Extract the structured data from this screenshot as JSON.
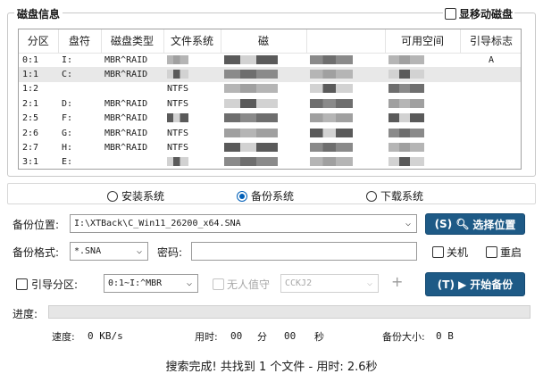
{
  "disk_info": {
    "title": "磁盘信息",
    "show_mobile_disk_label": "显移动磁盘",
    "columns": [
      "分区",
      "盘符",
      "磁盘类型",
      "文件系统",
      "磁",
      "",
      "可用空间",
      "引导标志"
    ],
    "rows": [
      {
        "partition": "0:1",
        "drive": "I:",
        "disk_type": "MBR^RAID",
        "fs": "",
        "boot": "A"
      },
      {
        "partition": "1:1",
        "drive": "C:",
        "disk_type": "MBR^RAID",
        "fs": "",
        "boot": ""
      },
      {
        "partition": "1:2",
        "drive": "",
        "disk_type": "",
        "fs": "NTFS",
        "boot": ""
      },
      {
        "partition": "2:1",
        "drive": "D:",
        "disk_type": "MBR^RAID",
        "fs": "NTFS",
        "boot": ""
      },
      {
        "partition": "2:5",
        "drive": "F:",
        "disk_type": "MBR^RAID",
        "fs": "",
        "boot": ""
      },
      {
        "partition": "2:6",
        "drive": "G:",
        "disk_type": "MBR^RAID",
        "fs": "NTFS",
        "boot": ""
      },
      {
        "partition": "2:7",
        "drive": "H:",
        "disk_type": "MBR^RAID",
        "fs": "NTFS",
        "boot": ""
      },
      {
        "partition": "3:1",
        "drive": "E:",
        "disk_type": "",
        "fs": "",
        "boot": ""
      }
    ],
    "selected_row": 1
  },
  "modes": {
    "install": "安装系统",
    "backup": "备份系统",
    "download": "下载系统",
    "selected": "backup"
  },
  "backup_location": {
    "label": "备份位置:",
    "value": "I:\\XTBack\\C_Win11_26200_x64.SNA",
    "button_label": "选择位置",
    "button_key": "(S)"
  },
  "backup_format": {
    "label": "备份格式:",
    "value": "*.SNA",
    "password_label": "密码:",
    "password_value": "",
    "shutdown_label": "关机",
    "restart_label": "重启"
  },
  "boot_partition": {
    "label": "引导分区:",
    "value": "0:1~I:^MBR",
    "unattended_label": "无人值守",
    "unattended_value": "CCKJ2",
    "add_symbol": "+",
    "start_button_label": "开始备份",
    "start_button_key": "(T)"
  },
  "progress": {
    "label": "进度:",
    "fraction": 0.0
  },
  "stats": {
    "speed_label": "速度:",
    "speed_value": "0 KB/s",
    "time_label": "用时:",
    "minutes": "00",
    "minutes_unit": "分",
    "seconds": "00",
    "seconds_unit": "秒",
    "size_label": "备份大小:",
    "size_value": "0 B"
  },
  "status_text": "搜索完成! 共找到 1 个文件 - 用时: 2.6秒"
}
